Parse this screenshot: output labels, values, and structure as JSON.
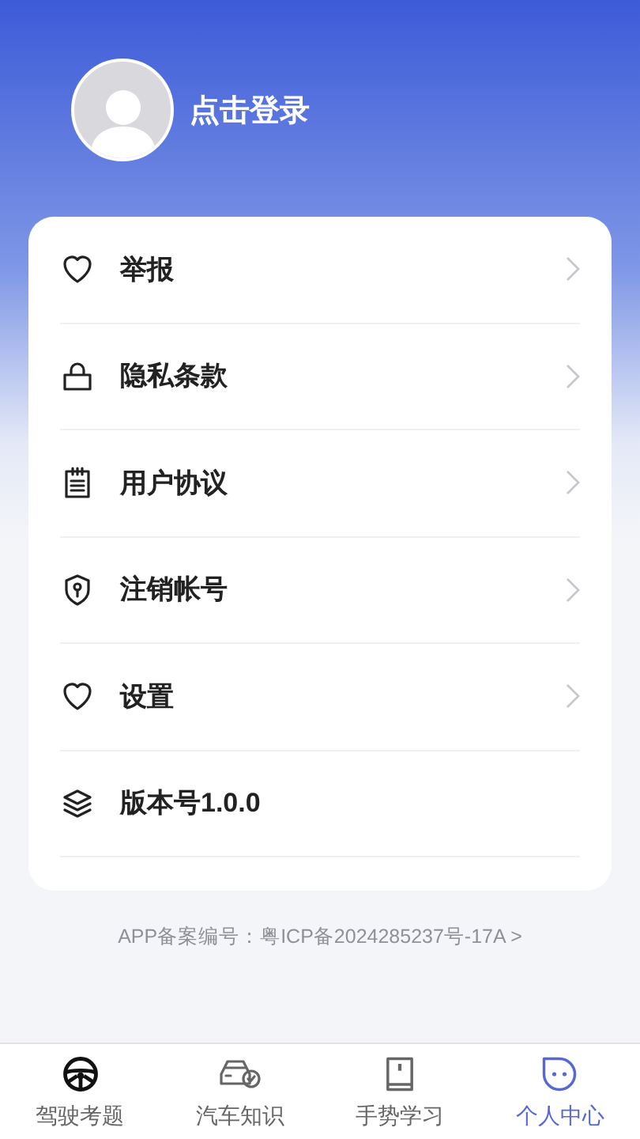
{
  "profile": {
    "login_label": "点击登录"
  },
  "menu": [
    {
      "label": "举报",
      "kind": "link"
    },
    {
      "label": "隐私条款",
      "kind": "link"
    },
    {
      "label": "用户协议",
      "kind": "link"
    },
    {
      "label": "注销帐号",
      "kind": "link"
    },
    {
      "label": "设置",
      "kind": "link"
    },
    {
      "label": "版本号1.0.0",
      "kind": "info"
    }
  ],
  "footer": {
    "icp": "APP备案编号：粤ICP备2024285237号-17A >"
  },
  "tabs": [
    {
      "label": "驾驶考题",
      "selected": false
    },
    {
      "label": "汽车知识",
      "selected": false
    },
    {
      "label": "手势学习",
      "selected": false
    },
    {
      "label": "个人中心",
      "selected": true
    }
  ]
}
